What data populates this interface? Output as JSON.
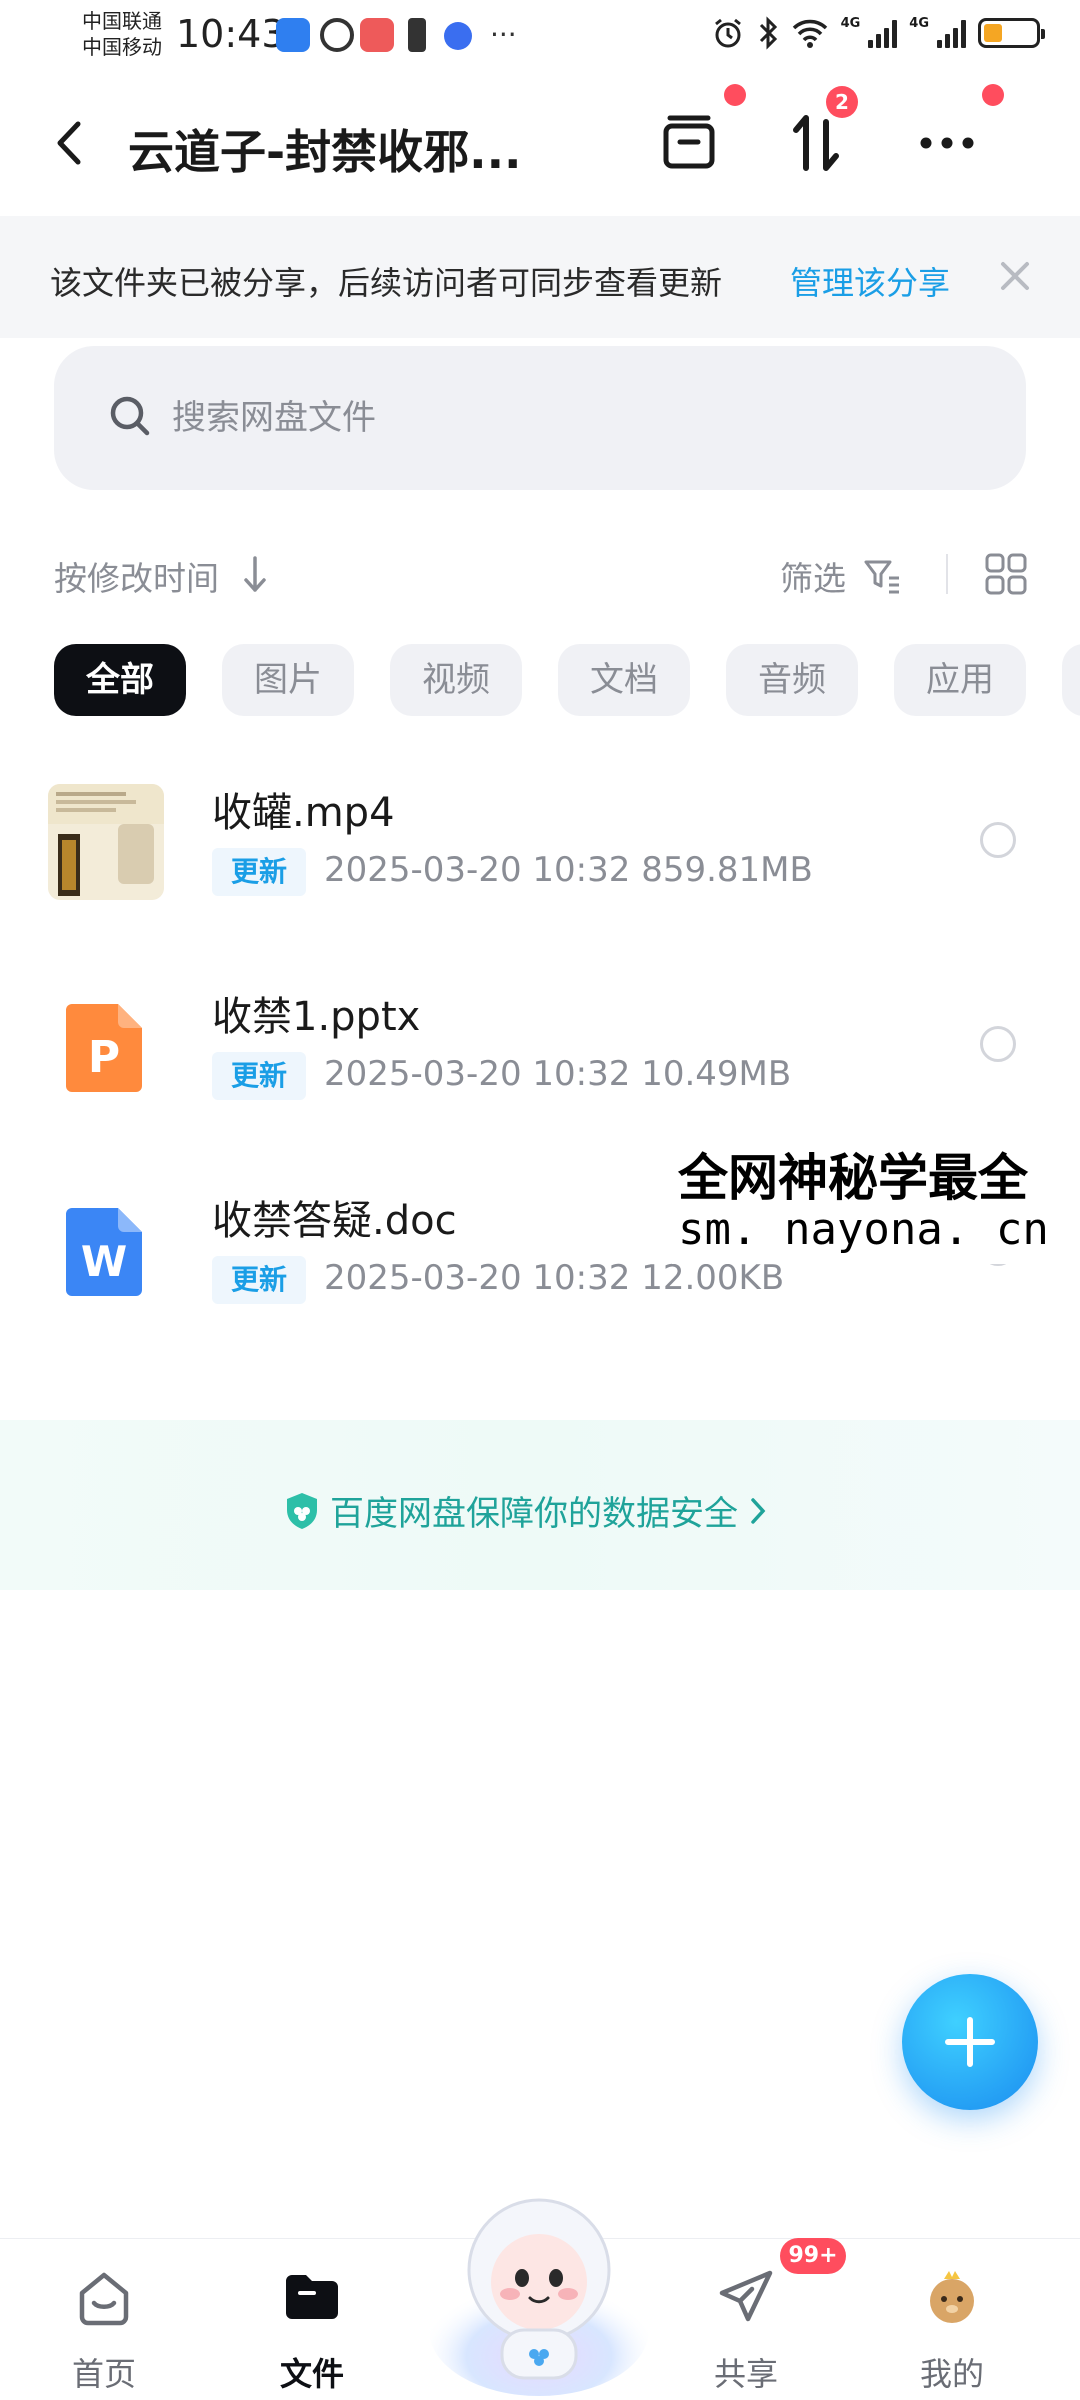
{
  "status_bar": {
    "carrier_1": "中国联通",
    "carrier_2": "中国移动",
    "time": "10:43",
    "network_1": "4G",
    "network_2": "4G",
    "battery_level": 0.35
  },
  "header": {
    "title": "云道子-封禁收邪...",
    "transfer_badge": "2"
  },
  "banner": {
    "text": "该文件夹已被分享，后续访问者可同步查看更新",
    "link": "管理该分享"
  },
  "search": {
    "placeholder": "搜索网盘文件"
  },
  "sort": {
    "label": "按修改时间",
    "filter_label": "筛选"
  },
  "categories": [
    "全部",
    "图片",
    "视频",
    "文档",
    "音频",
    "应用"
  ],
  "files": [
    {
      "name": "收罐.mp4",
      "tag": "更新",
      "date": "2025-03-20",
      "time": "10:32",
      "size": "859.81MB",
      "type": "video-icon"
    },
    {
      "name": "收禁1.pptx",
      "tag": "更新",
      "date": "2025-03-20",
      "time": "10:32",
      "size": "10.49MB",
      "type": "ppt-icon"
    },
    {
      "name": "收禁答疑.doc",
      "tag": "更新",
      "date": "2025-03-20",
      "time": "10:32",
      "size": "12.00KB",
      "type": "word-icon"
    }
  ],
  "watermark": {
    "line1": "全网神秘学最全",
    "line2": "sm. nayona. cn"
  },
  "safety": {
    "text": "百度网盘保障你的数据安全"
  },
  "bottom_nav": {
    "home": "首页",
    "files": "文件",
    "share": "共享",
    "share_badge": "99+",
    "mine": "我的"
  },
  "colors": {
    "accent": "#1a9ee6",
    "badge": "#ff4d5e",
    "safety_green": "#1fa39a",
    "chip_active": "#0d0f14"
  }
}
